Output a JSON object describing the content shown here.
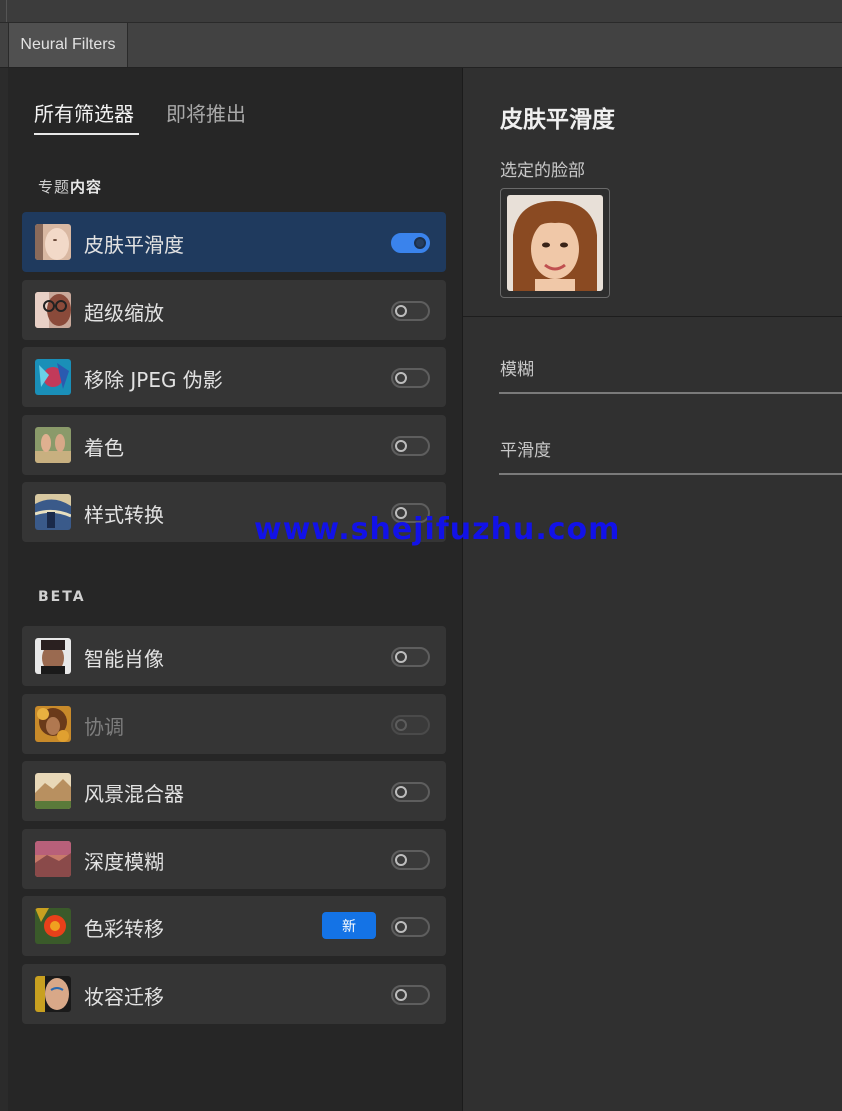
{
  "window": {
    "tab_label": "Neural Filters"
  },
  "filter_tabs": {
    "all": "所有筛选器",
    "coming_soon": "即将推出"
  },
  "sections": {
    "featured_prefix": "专题",
    "featured_bold": "内容",
    "beta": "BETA"
  },
  "featured_items": [
    {
      "label": "皮肤平滑度",
      "icon": "skin-smoothing-thumb",
      "enabled": true,
      "selected": true
    },
    {
      "label": "超级缩放",
      "icon": "super-zoom-thumb",
      "enabled": false
    },
    {
      "label": "移除 JPEG 伪影",
      "icon": "jpeg-artifacts-thumb",
      "enabled": false
    },
    {
      "label": "着色",
      "icon": "colorize-thumb",
      "enabled": false
    },
    {
      "label": "样式转换",
      "icon": "style-transfer-thumb",
      "enabled": false
    }
  ],
  "beta_items": [
    {
      "label": "智能肖像",
      "icon": "smart-portrait-thumb",
      "enabled": false
    },
    {
      "label": "协调",
      "icon": "harmonization-thumb",
      "enabled": false,
      "disabled": true
    },
    {
      "label": "风景混合器",
      "icon": "landscape-mixer-thumb",
      "enabled": false
    },
    {
      "label": "深度模糊",
      "icon": "depth-blur-thumb",
      "enabled": false
    },
    {
      "label": "色彩转移",
      "icon": "color-transfer-thumb",
      "enabled": false,
      "badge": "新"
    },
    {
      "label": "妆容迁移",
      "icon": "makeup-transfer-thumb",
      "enabled": false
    }
  ],
  "detail": {
    "title": "皮肤平滑度",
    "selected_face_label": "选定的脸部",
    "sliders": [
      {
        "label": "模糊"
      },
      {
        "label": "平滑度"
      }
    ]
  },
  "watermark": "www.shejifuzhu.com",
  "colors": {
    "accent": "#3a83ec",
    "selected_row": "#1f3a5e",
    "badge": "#1473e6",
    "watermark": "#1212e8"
  }
}
